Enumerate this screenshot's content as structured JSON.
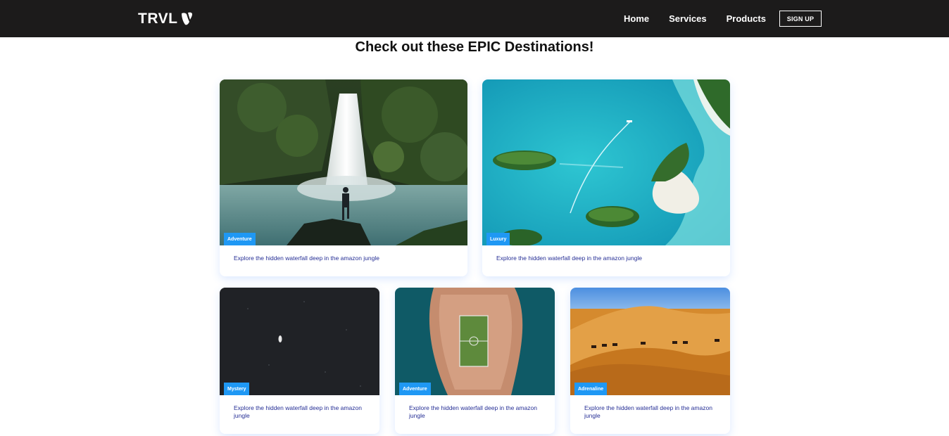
{
  "navbar": {
    "brand": "TRVL",
    "links": [
      "Home",
      "Services",
      "Products"
    ],
    "signup": "SIGN UP",
    "background": "#1c1b1b"
  },
  "page": {
    "title": "Check out these EPIC Destinations!"
  },
  "cards": [
    {
      "tag": "Adventure",
      "text": "Explore the hidden waterfall deep in the amazon jungle",
      "image": "waterfall-image"
    },
    {
      "tag": "Luxury",
      "text": "Explore the hidden waterfall deep in the amazon jungle",
      "image": "tropical-lagoon-image"
    },
    {
      "tag": "Mystery",
      "text": "Explore the hidden waterfall deep in the amazon jungle",
      "image": "dark-ocean-image"
    },
    {
      "tag": "Adventure",
      "text": "Explore the hidden waterfall deep in the amazon jungle",
      "image": "island-football-field-image"
    },
    {
      "tag": "Adrenaline",
      "text": "Explore the hidden waterfall deep in the amazon jungle",
      "image": "desert-caravan-image"
    }
  ],
  "colors": {
    "tag": "#1f98f4",
    "card_text": "#252e95"
  }
}
